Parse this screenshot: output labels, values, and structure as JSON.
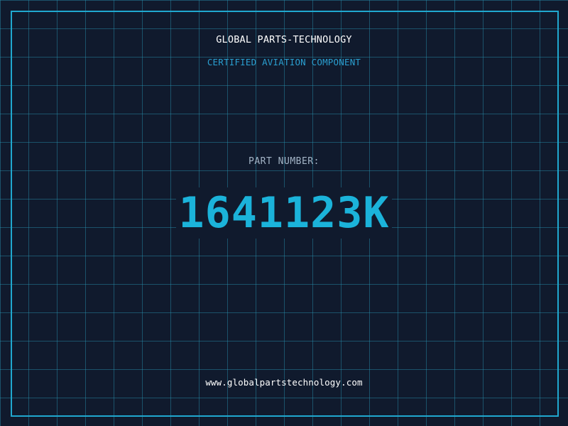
{
  "header": {
    "company": "GLOBAL PARTS-TECHNOLOGY",
    "subtitle": "CERTIFIED AVIATION COMPONENT"
  },
  "part": {
    "label": "PART NUMBER:",
    "number": "1641123K"
  },
  "footer": {
    "url": "www.globalpartstechnology.com"
  },
  "colors": {
    "background": "#101a2d",
    "grid": "#2896b4",
    "frame": "#20a8cf",
    "accent": "#1bb3da",
    "subtitle": "#2a9fd0",
    "label": "#a3b4c6",
    "text": "#ffffff"
  }
}
